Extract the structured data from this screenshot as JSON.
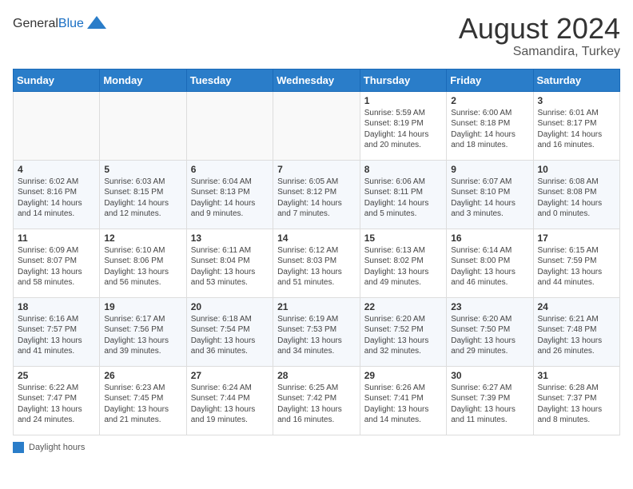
{
  "header": {
    "logo_general": "General",
    "logo_blue": "Blue",
    "month_year": "August 2024",
    "location": "Samandira, Turkey"
  },
  "days_of_week": [
    "Sunday",
    "Monday",
    "Tuesday",
    "Wednesday",
    "Thursday",
    "Friday",
    "Saturday"
  ],
  "weeks": [
    [
      {
        "num": "",
        "content": ""
      },
      {
        "num": "",
        "content": ""
      },
      {
        "num": "",
        "content": ""
      },
      {
        "num": "",
        "content": ""
      },
      {
        "num": "1",
        "content": "Sunrise: 5:59 AM\nSunset: 8:19 PM\nDaylight: 14 hours and 20 minutes."
      },
      {
        "num": "2",
        "content": "Sunrise: 6:00 AM\nSunset: 8:18 PM\nDaylight: 14 hours and 18 minutes."
      },
      {
        "num": "3",
        "content": "Sunrise: 6:01 AM\nSunset: 8:17 PM\nDaylight: 14 hours and 16 minutes."
      }
    ],
    [
      {
        "num": "4",
        "content": "Sunrise: 6:02 AM\nSunset: 8:16 PM\nDaylight: 14 hours and 14 minutes."
      },
      {
        "num": "5",
        "content": "Sunrise: 6:03 AM\nSunset: 8:15 PM\nDaylight: 14 hours and 12 minutes."
      },
      {
        "num": "6",
        "content": "Sunrise: 6:04 AM\nSunset: 8:13 PM\nDaylight: 14 hours and 9 minutes."
      },
      {
        "num": "7",
        "content": "Sunrise: 6:05 AM\nSunset: 8:12 PM\nDaylight: 14 hours and 7 minutes."
      },
      {
        "num": "8",
        "content": "Sunrise: 6:06 AM\nSunset: 8:11 PM\nDaylight: 14 hours and 5 minutes."
      },
      {
        "num": "9",
        "content": "Sunrise: 6:07 AM\nSunset: 8:10 PM\nDaylight: 14 hours and 3 minutes."
      },
      {
        "num": "10",
        "content": "Sunrise: 6:08 AM\nSunset: 8:08 PM\nDaylight: 14 hours and 0 minutes."
      }
    ],
    [
      {
        "num": "11",
        "content": "Sunrise: 6:09 AM\nSunset: 8:07 PM\nDaylight: 13 hours and 58 minutes."
      },
      {
        "num": "12",
        "content": "Sunrise: 6:10 AM\nSunset: 8:06 PM\nDaylight: 13 hours and 56 minutes."
      },
      {
        "num": "13",
        "content": "Sunrise: 6:11 AM\nSunset: 8:04 PM\nDaylight: 13 hours and 53 minutes."
      },
      {
        "num": "14",
        "content": "Sunrise: 6:12 AM\nSunset: 8:03 PM\nDaylight: 13 hours and 51 minutes."
      },
      {
        "num": "15",
        "content": "Sunrise: 6:13 AM\nSunset: 8:02 PM\nDaylight: 13 hours and 49 minutes."
      },
      {
        "num": "16",
        "content": "Sunrise: 6:14 AM\nSunset: 8:00 PM\nDaylight: 13 hours and 46 minutes."
      },
      {
        "num": "17",
        "content": "Sunrise: 6:15 AM\nSunset: 7:59 PM\nDaylight: 13 hours and 44 minutes."
      }
    ],
    [
      {
        "num": "18",
        "content": "Sunrise: 6:16 AM\nSunset: 7:57 PM\nDaylight: 13 hours and 41 minutes."
      },
      {
        "num": "19",
        "content": "Sunrise: 6:17 AM\nSunset: 7:56 PM\nDaylight: 13 hours and 39 minutes."
      },
      {
        "num": "20",
        "content": "Sunrise: 6:18 AM\nSunset: 7:54 PM\nDaylight: 13 hours and 36 minutes."
      },
      {
        "num": "21",
        "content": "Sunrise: 6:19 AM\nSunset: 7:53 PM\nDaylight: 13 hours and 34 minutes."
      },
      {
        "num": "22",
        "content": "Sunrise: 6:20 AM\nSunset: 7:52 PM\nDaylight: 13 hours and 32 minutes."
      },
      {
        "num": "23",
        "content": "Sunrise: 6:20 AM\nSunset: 7:50 PM\nDaylight: 13 hours and 29 minutes."
      },
      {
        "num": "24",
        "content": "Sunrise: 6:21 AM\nSunset: 7:48 PM\nDaylight: 13 hours and 26 minutes."
      }
    ],
    [
      {
        "num": "25",
        "content": "Sunrise: 6:22 AM\nSunset: 7:47 PM\nDaylight: 13 hours and 24 minutes."
      },
      {
        "num": "26",
        "content": "Sunrise: 6:23 AM\nSunset: 7:45 PM\nDaylight: 13 hours and 21 minutes."
      },
      {
        "num": "27",
        "content": "Sunrise: 6:24 AM\nSunset: 7:44 PM\nDaylight: 13 hours and 19 minutes."
      },
      {
        "num": "28",
        "content": "Sunrise: 6:25 AM\nSunset: 7:42 PM\nDaylight: 13 hours and 16 minutes."
      },
      {
        "num": "29",
        "content": "Sunrise: 6:26 AM\nSunset: 7:41 PM\nDaylight: 13 hours and 14 minutes."
      },
      {
        "num": "30",
        "content": "Sunrise: 6:27 AM\nSunset: 7:39 PM\nDaylight: 13 hours and 11 minutes."
      },
      {
        "num": "31",
        "content": "Sunrise: 6:28 AM\nSunset: 7:37 PM\nDaylight: 13 hours and 8 minutes."
      }
    ]
  ],
  "legend": {
    "label": "Daylight hours"
  }
}
